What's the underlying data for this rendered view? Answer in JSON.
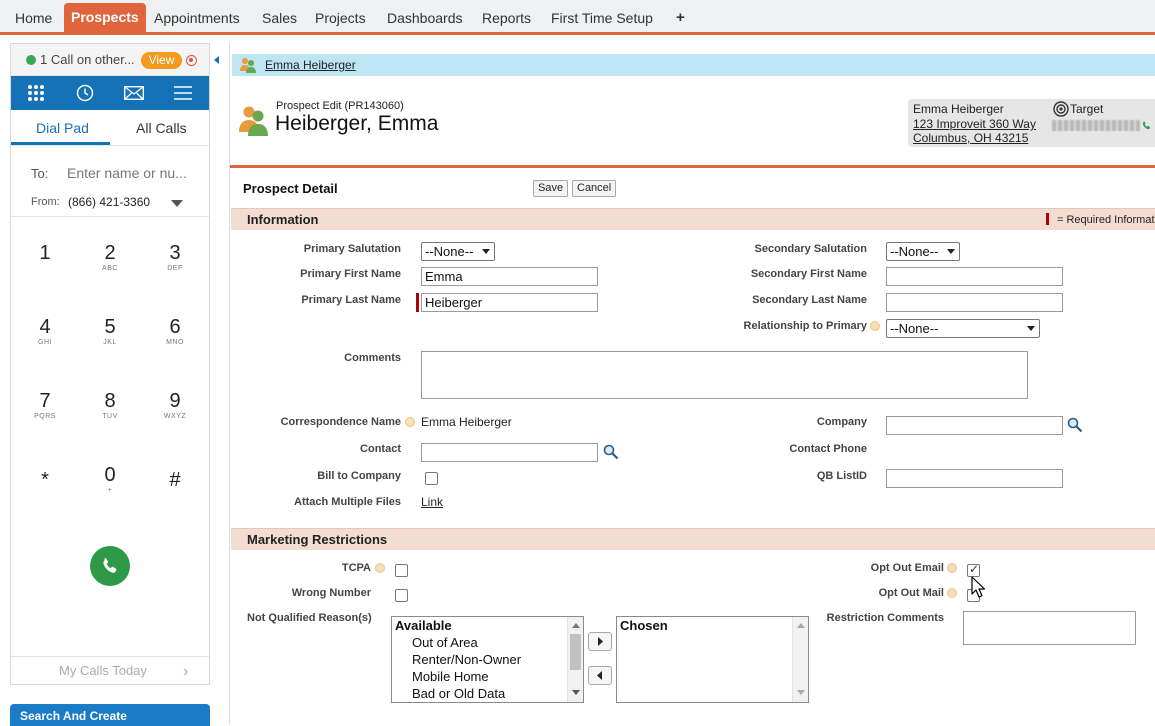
{
  "nav": {
    "tabs": [
      {
        "label": "Home",
        "active": false
      },
      {
        "label": "Prospects",
        "active": true
      },
      {
        "label": "Appointments",
        "active": false
      },
      {
        "label": "Sales",
        "active": false
      },
      {
        "label": "Projects",
        "active": false
      },
      {
        "label": "Dashboards",
        "active": false
      },
      {
        "label": "Reports",
        "active": false
      },
      {
        "label": "First Time Setup",
        "active": false
      }
    ],
    "add_label": "+"
  },
  "dialer": {
    "call_status": "1 Call on other...",
    "view_label": "View",
    "icons": [
      "dialpad-icon",
      "history-icon",
      "mail-icon",
      "menu-icon"
    ],
    "tabs": {
      "dial_pad": "Dial Pad",
      "all_calls": "All Calls"
    },
    "to_label": "To:",
    "to_placeholder": "Enter name or nu...",
    "from_label": "From:",
    "from_value": "(866) 421-3360",
    "keys": [
      {
        "digit": "1",
        "letters": ""
      },
      {
        "digit": "2",
        "letters": "ABC"
      },
      {
        "digit": "3",
        "letters": "DEF"
      },
      {
        "digit": "4",
        "letters": "GHI"
      },
      {
        "digit": "5",
        "letters": "JKL"
      },
      {
        "digit": "6",
        "letters": "MNO"
      },
      {
        "digit": "7",
        "letters": "PQRS"
      },
      {
        "digit": "8",
        "letters": "TUV"
      },
      {
        "digit": "9",
        "letters": "WXYZ"
      },
      {
        "digit": "*",
        "letters": ""
      },
      {
        "digit": "0",
        "letters": "+"
      },
      {
        "digit": "#",
        "letters": ""
      }
    ],
    "my_calls_label": "My Calls Today",
    "my_calls_chevron": "›",
    "search_create_label": "Search And Create"
  },
  "breadcrumb": {
    "label": "Emma Heiberger"
  },
  "header": {
    "edit_label": "Prospect Edit (PR143060)",
    "title": "Heiberger, Emma"
  },
  "contact_card": {
    "name": "Emma Heiberger",
    "address_line1": "123 Improveit 360 Way",
    "address_line2": "Columbus, OH 43215",
    "target_label": "Target"
  },
  "panel": {
    "title": "Prospect Detail",
    "save_label": "Save",
    "cancel_label": "Cancel"
  },
  "information": {
    "section_title": "Information",
    "required_note": "= Required Informati",
    "primary_salutation": {
      "label": "Primary Salutation",
      "value": "--None--"
    },
    "primary_first_name": {
      "label": "Primary First Name",
      "value": "Emma"
    },
    "primary_last_name": {
      "label": "Primary Last Name",
      "value": "Heiberger"
    },
    "secondary_salutation": {
      "label": "Secondary Salutation",
      "value": "--None--"
    },
    "secondary_first_name": {
      "label": "Secondary First Name",
      "value": ""
    },
    "secondary_last_name": {
      "label": "Secondary Last Name",
      "value": ""
    },
    "relationship": {
      "label": "Relationship to Primary",
      "value": "--None--"
    },
    "comments": {
      "label": "Comments",
      "value": ""
    },
    "correspondence_name": {
      "label": "Correspondence Name",
      "value": "Emma Heiberger"
    },
    "contact": {
      "label": "Contact",
      "value": ""
    },
    "bill_to_company": {
      "label": "Bill to Company",
      "checked": false
    },
    "attach_files": {
      "label": "Attach Multiple Files",
      "link": "Link"
    },
    "company": {
      "label": "Company",
      "value": ""
    },
    "contact_phone": {
      "label": "Contact Phone",
      "value": ""
    },
    "qb_listid": {
      "label": "QB ListID",
      "value": ""
    }
  },
  "marketing": {
    "section_title": "Marketing Restrictions",
    "tcpa": {
      "label": "TCPA",
      "checked": false
    },
    "wrong_number": {
      "label": "Wrong Number",
      "checked": false
    },
    "not_qualified": {
      "label": "Not Qualified Reason(s)",
      "available_header": "Available",
      "available": [
        "Out of Area",
        "Renter/Non-Owner",
        "Mobile Home",
        "Bad or Old Data"
      ],
      "chosen_header": "Chosen"
    },
    "opt_out_email": {
      "label": "Opt Out Email",
      "checked": true
    },
    "opt_out_mail": {
      "label": "Opt Out Mail",
      "checked": false
    },
    "restriction_comments": {
      "label": "Restriction Comments",
      "value": ""
    }
  },
  "colors": {
    "accent": "#e0653c",
    "dialer_blue": "#1672b7",
    "section_bg": "#f3ddd3",
    "breadcrumb_bg": "#bde5f3",
    "call_green": "#2e9a48"
  }
}
